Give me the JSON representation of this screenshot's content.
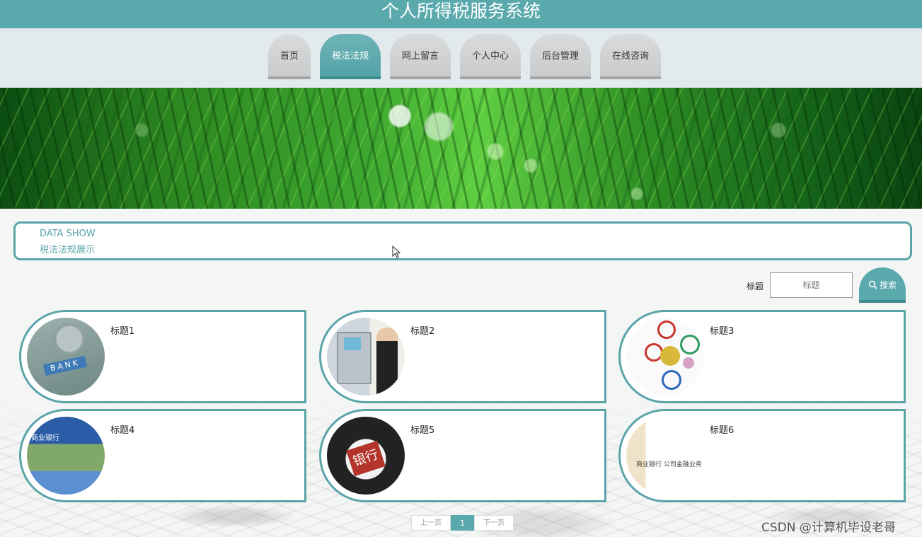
{
  "header": {
    "title": "个人所得税服务系统"
  },
  "nav": {
    "items": [
      {
        "label": "首页"
      },
      {
        "label": "税法法规",
        "active": true
      },
      {
        "label": "网上留言"
      },
      {
        "label": "个人中心"
      },
      {
        "label": "后台管理"
      },
      {
        "label": "在线咨询"
      }
    ]
  },
  "section": {
    "en": "DATA SHOW",
    "zh": "税法法规展示"
  },
  "search": {
    "label": "标题",
    "placeholder": "标题",
    "button": "搜索",
    "icon": "search-icon"
  },
  "cards": [
    {
      "title": "标题1",
      "thumb_text": "BANK"
    },
    {
      "title": "标题2"
    },
    {
      "title": "标题3"
    },
    {
      "title": "标题4",
      "thumb_text": "商业银行"
    },
    {
      "title": "标题5",
      "thumb_text": "银行"
    },
    {
      "title": "标题6",
      "thumb_text": "商业银行 公司金融业务"
    }
  ],
  "pagination": {
    "prev": "上一页",
    "current": "1",
    "next": "下一页"
  },
  "watermark": "CSDN @计算机毕设老哥",
  "colors": {
    "accent": "#5aa9ad",
    "border": "#5aa4a8"
  }
}
